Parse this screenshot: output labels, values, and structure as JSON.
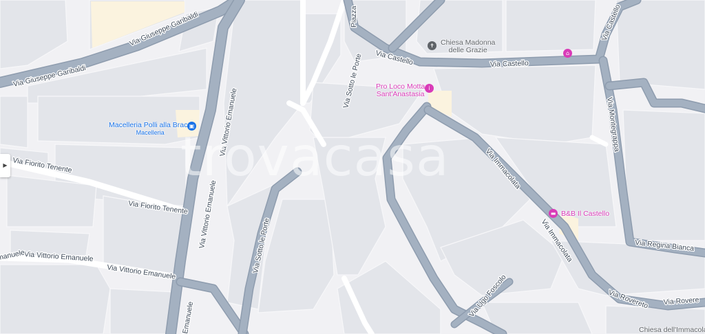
{
  "map": {
    "watermark": "trovacasa",
    "colors": {
      "background": "#f1f1f4",
      "block": "#e3e5ea",
      "main_road": "#a4b1c1",
      "highlight_area": "#fbf3df",
      "poi_blue": "#1a73e8",
      "poi_pink": "#d93bb8"
    },
    "streets": {
      "garibaldi_1": "Via Giuseppe Garibaldi",
      "garibaldi_2": "Via Giuseppe Garibaldi",
      "vittorio_1": "Via Vittorio Emanuele",
      "vittorio_2": "Via Vittorio Emanuele",
      "vittorio_3": "Via Vittorio Emanuele",
      "vittorio_4": "Via Vittorio Emanuele",
      "vittorio_5": "Emanuele",
      "vittorio_6": "Emanuele",
      "piazza": "Piazza",
      "castello_1": "Via Castello",
      "castello_2": "Via Castello",
      "castello_3": "Via Castello",
      "sotto_porte_1": "Via Sotto le Porte",
      "sotto_porte_2": "Via Sotto le Porte",
      "fiorito_1": "Via Fiorito Tenente",
      "fiorito_2": "Via Fiorito Tenente",
      "immacolata_1": "Via Immacolata",
      "immacolata_2": "Via Immacolata",
      "montegrappa": "Via Montegrappa",
      "regina": "Via Regina Bianca",
      "rovereto_1": "Via Rovereto",
      "rovereto_2": "Via Rovere",
      "foscolo": "Via Ugo Foscolo"
    },
    "pois": {
      "chiesa_madonna": {
        "line1": "Chiesa Madonna",
        "line2": "delle Grazie",
        "icon": "church-icon"
      },
      "pro_loco": {
        "line1": "Pro Loco Motta",
        "line2": "Sant'Anastasia",
        "icon": "info-icon"
      },
      "macelleria": {
        "line1": "Macelleria Polli alla Brace",
        "line2": "Macelleria",
        "icon": "shop-icon"
      },
      "bb_castello": {
        "line1": "B&B Il Castello",
        "icon": "bed-icon"
      },
      "chiesa_immacolata": {
        "line1": "Chiesa dell'Immacolata"
      },
      "castello_pin": {
        "icon": "landmark-icon"
      }
    }
  }
}
